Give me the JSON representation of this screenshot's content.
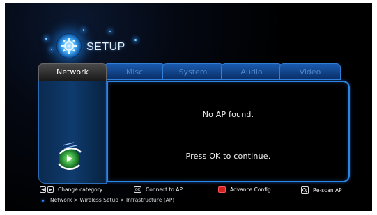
{
  "header": {
    "title": "SETUP",
    "icon": "gear-icon"
  },
  "tabs": [
    {
      "label": "Network",
      "active": true
    },
    {
      "label": "Misc",
      "active": false
    },
    {
      "label": "System",
      "active": false
    },
    {
      "label": "Audio",
      "active": false
    },
    {
      "label": "Video",
      "active": false
    }
  ],
  "content": {
    "message_1": "No AP found.",
    "message_2": "Press OK to continue."
  },
  "footer": {
    "hints": [
      {
        "icon": "left-right-arrow-icon",
        "label": "Change category"
      },
      {
        "icon": "ok-key-icon",
        "key_text": "OK",
        "label": "Connect to AP"
      },
      {
        "icon": "red-key-icon",
        "label": "Advance Config."
      },
      {
        "icon": "search-icon",
        "label": "Re-scan AP"
      }
    ],
    "breadcrumb": "Network > Wireless Setup > Infrastructure (AP)"
  },
  "colors": {
    "accent": "#2a86e3",
    "red_key": "#d21f1f"
  }
}
